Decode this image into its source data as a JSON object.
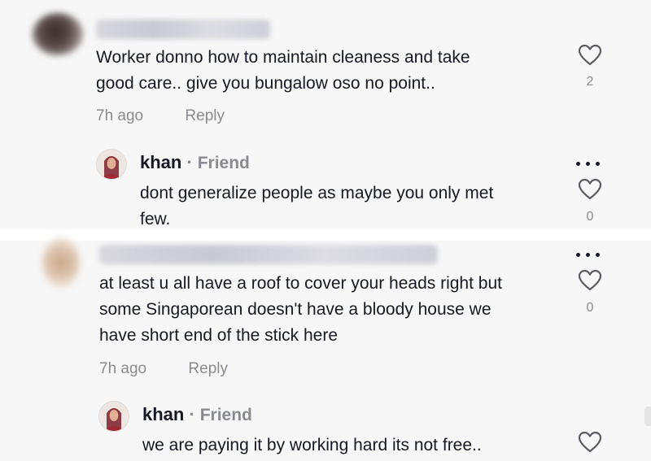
{
  "comments": [
    {
      "author_hidden": true,
      "text": "Worker donno how to maintain cleaness and take\ngood care.. give you bungalow oso no point..",
      "time": "7h ago",
      "reply_label": "Reply",
      "likes": "2"
    },
    {
      "author": "khan",
      "badge": "Friend",
      "separator": "·",
      "text": "dont generalize people as maybe you only met\nfew.",
      "likes": "0"
    },
    {
      "author_hidden": true,
      "text": "at least u all have a roof to cover your heads right but\nsome Singaporean doesn't have a bloody house we\nhave short end of the stick here",
      "time": "7h ago",
      "reply_label": "Reply",
      "likes": "0"
    },
    {
      "author": "khan",
      "badge": "Friend",
      "separator": "·",
      "text": "we are paying it by working hard its not free.."
    }
  ],
  "colors": {
    "text": "#161823",
    "muted": "#8a8b91",
    "background": "#f7f7f7"
  },
  "icons": [
    "heart-outline-icon",
    "more-options-icon"
  ]
}
